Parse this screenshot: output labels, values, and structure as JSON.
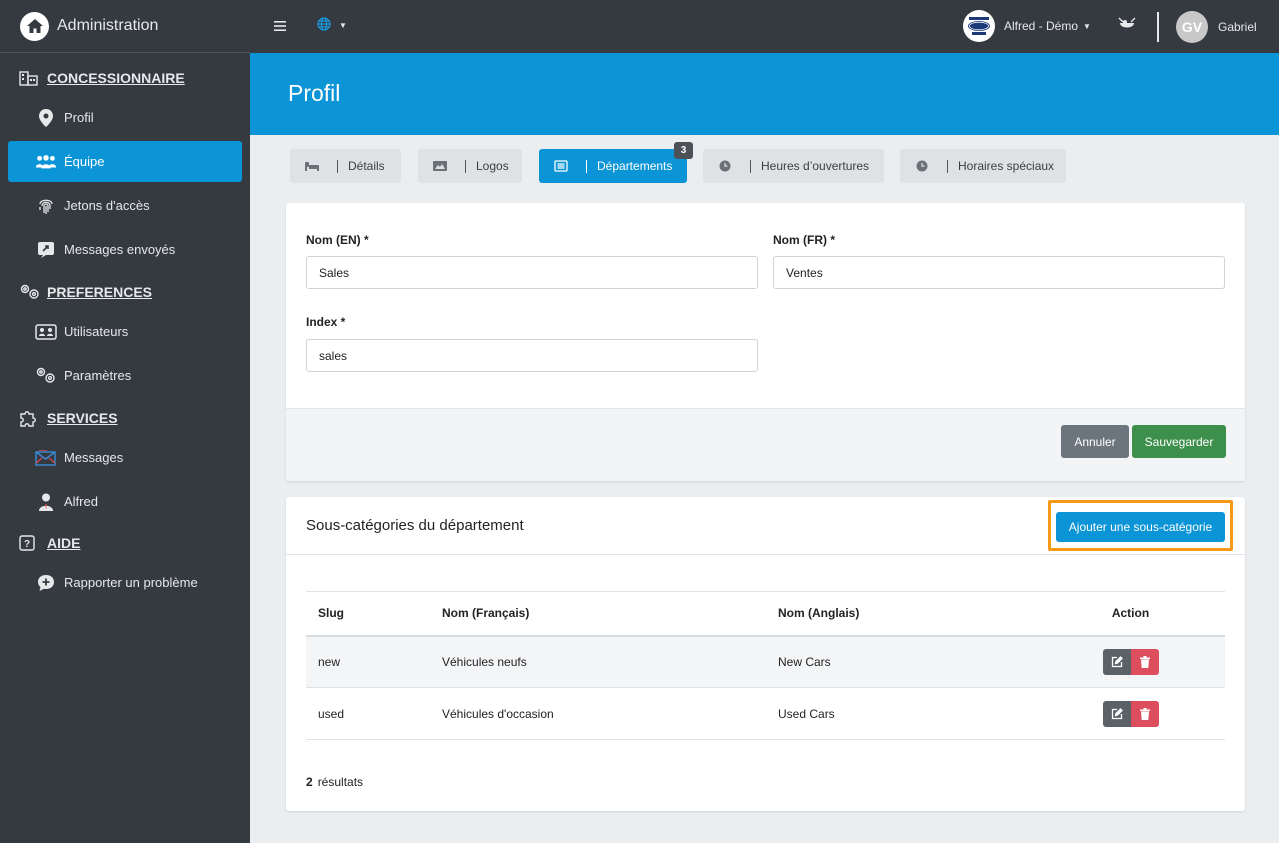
{
  "sidebar": {
    "brand": "Administration",
    "sections": [
      {
        "label": "CONCESSIONNAIRE",
        "items": [
          {
            "label": "Profil"
          },
          {
            "label": "Équipe"
          },
          {
            "label": "Jetons d'accès"
          },
          {
            "label": "Messages envoyés"
          }
        ]
      },
      {
        "label": "PREFERENCES",
        "items": [
          {
            "label": "Utilisateurs"
          },
          {
            "label": "Paramètres"
          }
        ]
      },
      {
        "label": "SERVICES",
        "items": [
          {
            "label": "Messages"
          },
          {
            "label": "Alfred"
          }
        ]
      },
      {
        "label": "AIDE",
        "items": [
          {
            "label": "Rapporter un problème"
          }
        ]
      }
    ]
  },
  "topbar": {
    "dealer_name": "Alfred - Démo",
    "user_initials": "GV",
    "user_name": "Gabriel"
  },
  "page": {
    "title": "Profil"
  },
  "tabs": [
    {
      "label": "Détails"
    },
    {
      "label": "Logos"
    },
    {
      "label": "Départements",
      "badge": "3"
    },
    {
      "label": "Heures d’ouvertures"
    },
    {
      "label": "Horaires spéciaux"
    }
  ],
  "form": {
    "name_en_label": "Nom (EN) *",
    "name_en_value": "Sales",
    "name_fr_label": "Nom (FR) *",
    "name_fr_value": "Ventes",
    "index_label": "Index *",
    "index_value": "sales",
    "cancel_label": "Annuler",
    "save_label": "Sauvegarder"
  },
  "subcategories": {
    "title": "Sous-catégories du département",
    "add_label": "Ajouter une sous-catégorie",
    "columns": [
      "Slug",
      "Nom (Français)",
      "Nom (Anglais)",
      "Action"
    ],
    "rows": [
      {
        "slug": "new",
        "name_fr": "Véhicules neufs",
        "name_en": "New Cars"
      },
      {
        "slug": "used",
        "name_fr": "Véhicules d'occasion",
        "name_en": "Used Cars"
      }
    ],
    "results_count": "2",
    "results_label": "résultats"
  },
  "colors": {
    "accent": "#0b94d6",
    "sidebar": "#343a40",
    "highlight": "#f59a15",
    "save": "#3d8f4c",
    "delete": "#dc4e5e"
  }
}
